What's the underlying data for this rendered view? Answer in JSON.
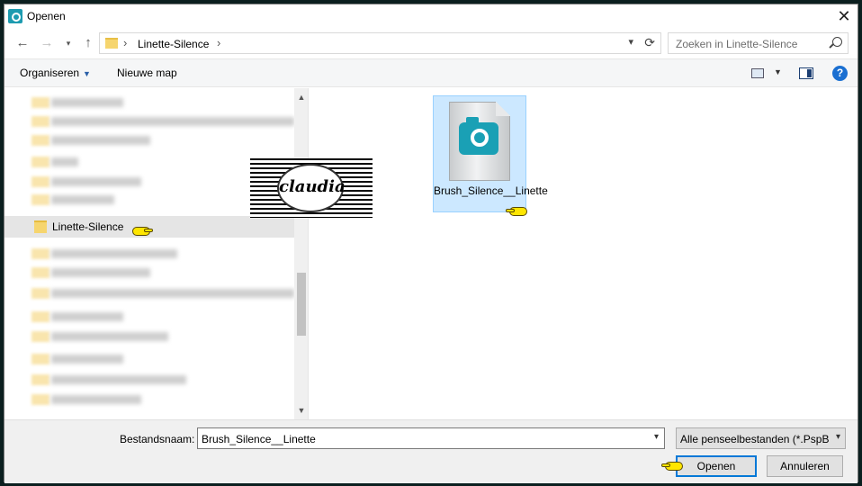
{
  "window": {
    "title": "Openen",
    "close_label": "✕"
  },
  "address": {
    "path": "Linette-Silence"
  },
  "search": {
    "placeholder": "Zoeken in Linette-Silence"
  },
  "toolbar": {
    "organize_label": "Organiseren",
    "new_folder_label": "Nieuwe map",
    "help_label": "?"
  },
  "nav": {
    "selected_folder": "Linette-Silence"
  },
  "files": [
    {
      "name": "Brush_Silence__Linette",
      "icon": "psp-brush-file-icon"
    }
  ],
  "watermark": {
    "text": "claudia"
  },
  "footer": {
    "filename_label": "Bestandsnaam:",
    "filename_value": "Brush_Silence__Linette",
    "filetype_value": "Alle penseelbestanden (*.PspBr",
    "open_label": "Openen",
    "cancel_label": "Annuleren"
  }
}
